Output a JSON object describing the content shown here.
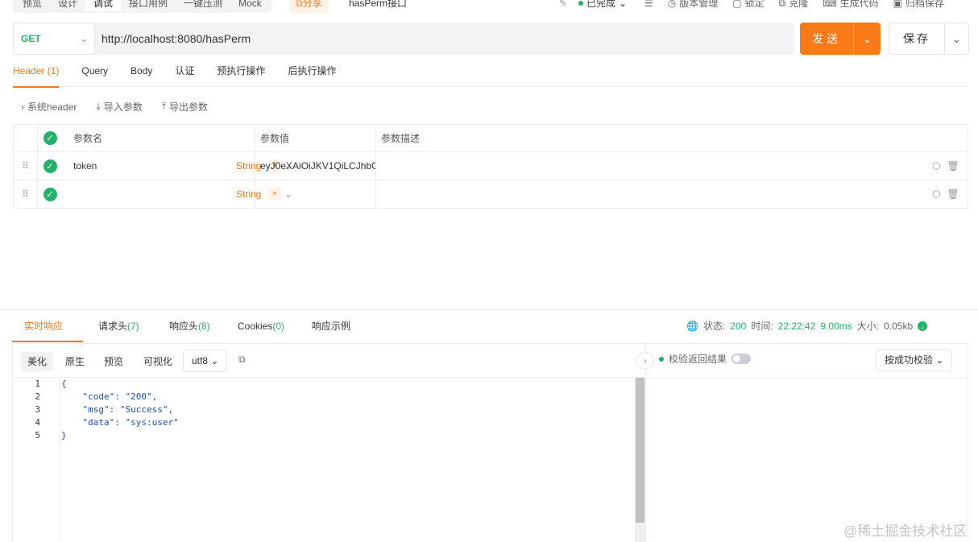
{
  "topbar": {
    "mode_tabs": [
      "预览",
      "设计",
      "调试",
      "接口用例",
      "一键压测",
      "Mock"
    ],
    "share_label": "分享",
    "api_name": "hasPerm接口",
    "status": "已完成",
    "actions": [
      "版本管理",
      "锁定",
      "克隆",
      "生成代码",
      "归档保存"
    ]
  },
  "request": {
    "method": "GET",
    "url": "http://localhost:8080/hasPerm",
    "send_label": "发送",
    "save_label": "保存"
  },
  "req_tabs": [
    "Header (1)",
    "Query",
    "Body",
    "认证",
    "预执行操作",
    "后执行操作"
  ],
  "header_actions": [
    "系统header",
    "导入参数",
    "导出参数"
  ],
  "params": {
    "columns": [
      "参数名",
      "参数值",
      "参数描述"
    ],
    "rows": [
      {
        "name": "token",
        "type": "String",
        "required": "*",
        "value": "eyJ0eXAiOiJKV1QiLCJhbG",
        "desc": ""
      },
      {
        "name": "",
        "type": "String",
        "required": "*",
        "value": "",
        "desc": ""
      }
    ]
  },
  "response": {
    "tabs": {
      "realtime": "实时响应",
      "req_headers": "请求头",
      "req_headers_count": "(7)",
      "resp_headers": "响应头",
      "resp_headers_count": "(8)",
      "cookies": "Cookies",
      "cookies_count": "(0)",
      "example": "响应示例"
    },
    "status_label": "状态:",
    "status": "200",
    "time_label": "时间:",
    "time": "22:22:42",
    "duration": "9.00ms",
    "size_label": "大小:",
    "size": "0.05kb",
    "format_buttons": [
      "美化",
      "原生",
      "预览",
      "可视化"
    ],
    "encoding": "utf8",
    "code_lines": [
      "{",
      "    \"code\": \"200\",",
      "    \"msg\": \"Success\",",
      "    \"data\": \"sys:user\"",
      "}"
    ],
    "line_numbers": [
      "1",
      "2",
      "3",
      "4",
      "5"
    ],
    "assert_label": "校验返回结果",
    "assert_select": "按成功校验"
  },
  "watermark": "@稀土掘金技术社区",
  "colors": {
    "accent": "#f5761a",
    "success": "#23b267",
    "send": "#fa7a17"
  }
}
